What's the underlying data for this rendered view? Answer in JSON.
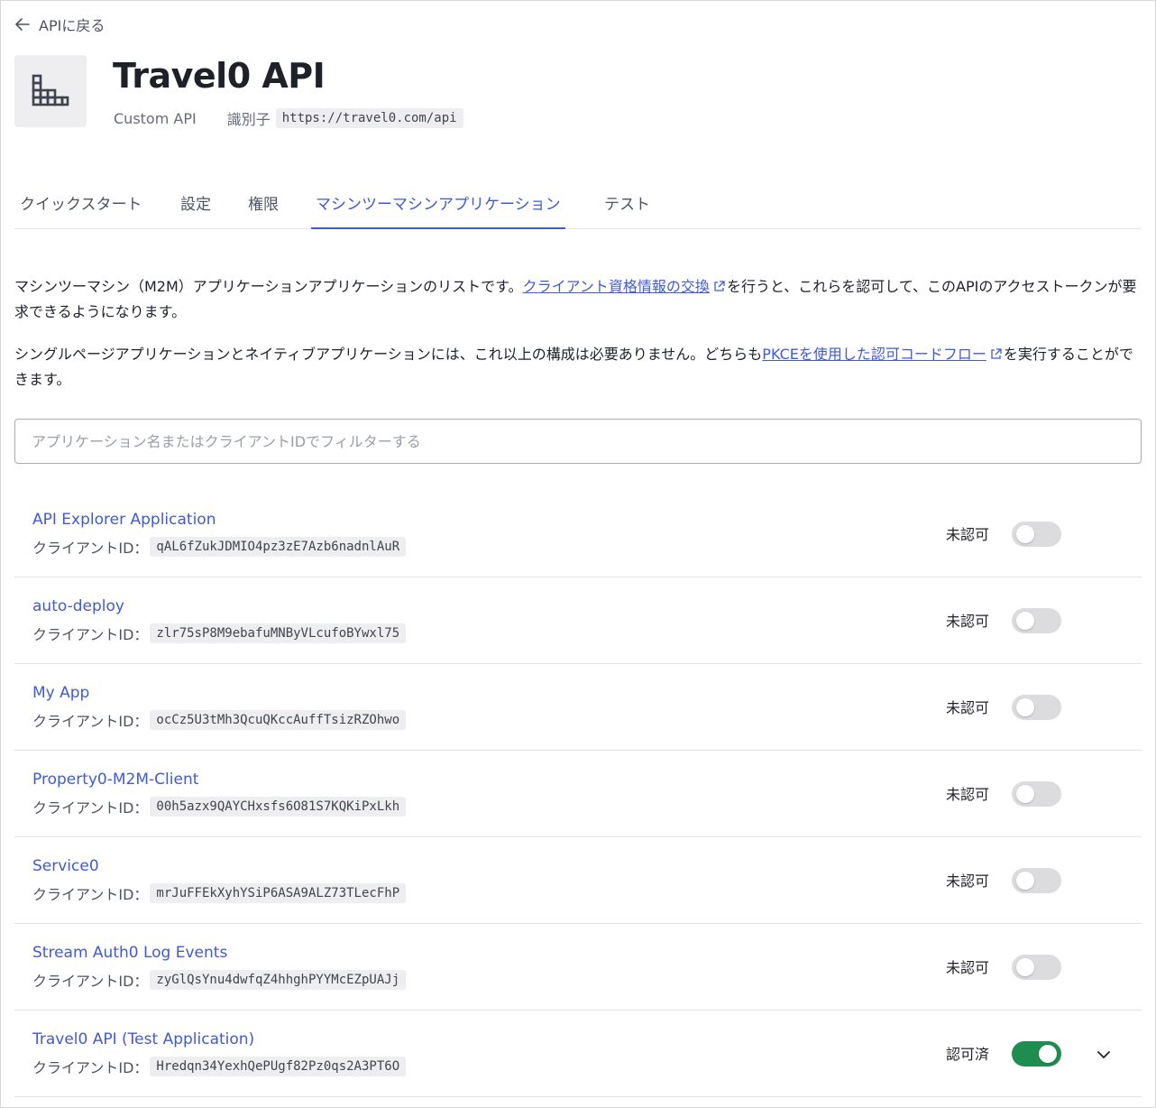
{
  "nav": {
    "back_label": "APIに戻る"
  },
  "api": {
    "title": "Travel0 API",
    "type": "Custom API",
    "identifier_label": "識別子",
    "identifier": "https://travel0.com/api"
  },
  "tabs": [
    {
      "label": "クイックスタート",
      "active": false
    },
    {
      "label": "設定",
      "active": false
    },
    {
      "label": "権限",
      "active": false
    },
    {
      "label": "マシンツーマシンアプリケーション",
      "active": true
    },
    {
      "label": "テスト",
      "active": false
    }
  ],
  "description": {
    "p1_before": "マシンツーマシン（M2M）アプリケーションアプリケーションのリストです。",
    "p1_link": "クライアント資格情報の交換",
    "p1_after": "を行うと、これらを認可して、このAPIのアクセストークンが要求できるようになります。",
    "p2_before": "シングルページアプリケーションとネイティブアプリケーションには、これ以上の構成は必要ありません。どちらも",
    "p2_link": "PKCEを使用した認可コードフロー",
    "p2_after": "を実行することができます。"
  },
  "filter": {
    "placeholder": "アプリケーション名またはクライアントIDでフィルターする",
    "value": ""
  },
  "client_id_label": "クライアントID：",
  "applications": [
    {
      "name": "API Explorer Application",
      "client_id": "qAL6fZukJDMIO4pz3zE7Azb6nadnlAuR",
      "status": "未認可",
      "authorized": false
    },
    {
      "name": "auto-deploy",
      "client_id": "zlr75sP8M9ebafuMNByVLcufoBYwxl75",
      "status": "未認可",
      "authorized": false
    },
    {
      "name": "My App",
      "client_id": "ocCz5U3tMh3QcuQKccAuffTsizRZOhwo",
      "status": "未認可",
      "authorized": false
    },
    {
      "name": "Property0-M2M-Client",
      "client_id": "00h5azx9QAYCHxsfs6O81S7KQKiPxLkh",
      "status": "未認可",
      "authorized": false
    },
    {
      "name": "Service0",
      "client_id": "mrJuFFEkXyhYSiP6ASA9ALZ73TLecFhP",
      "status": "未認可",
      "authorized": false
    },
    {
      "name": "Stream Auth0 Log Events",
      "client_id": "zyGlQsYnu4dwfqZ4hhghPYYMcEZpUAJj",
      "status": "未認可",
      "authorized": false
    },
    {
      "name": "Travel0 API (Test Application)",
      "client_id": "Hredqn34YexhQePUgf82Pz0qs2A3PT6O",
      "status": "認可済",
      "authorized": true
    }
  ],
  "colors": {
    "link": "#3e5bd6",
    "toggle_on": "#1e8e4e",
    "toggle_off": "#dcdcdf"
  },
  "icons": {
    "back": "arrow-left-icon",
    "api": "buildings-icon",
    "external": "external-link-icon",
    "expand": "chevron-down-icon"
  }
}
